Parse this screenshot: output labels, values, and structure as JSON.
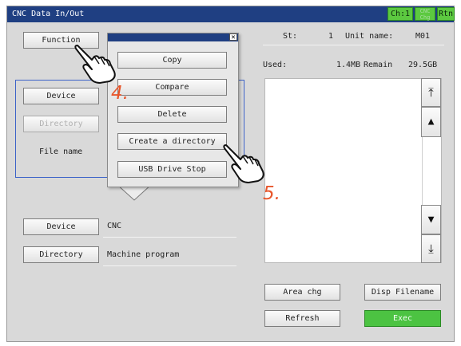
{
  "window": {
    "title": "CNC Data In/Out",
    "ch_label": "Ch:1",
    "cnc_chg_line1": "CNC",
    "cnc_chg_line2": "Chg",
    "rtn_label": "Rtn"
  },
  "status": {
    "st_label": "St:",
    "st_value": "1",
    "unit_label": "Unit name:",
    "unit_value": "M01",
    "used_label": "Used:",
    "used_value": "1.4MB",
    "remain_label": "Remain",
    "remain_value": "29.5GB"
  },
  "source": {
    "function_label": "Function",
    "device_label": "Device",
    "directory_label": "Directory",
    "filename_label": "File name"
  },
  "popup": {
    "close_glyph": "✕",
    "items": [
      "Copy",
      "Compare",
      "Delete",
      "Create a directory",
      "USB Drive Stop"
    ]
  },
  "dest": {
    "device_label": "Device",
    "device_value": "CNC",
    "directory_label": "Directory",
    "directory_value": "Machine program"
  },
  "scroll": {
    "top_glyph": "⤒",
    "up_glyph": "▲",
    "down_glyph": "▼",
    "bottom_glyph": "⤓"
  },
  "actions": {
    "area_chg": "Area chg",
    "disp_filename": "Disp Filename",
    "refresh": "Refresh",
    "exec": "Exec"
  },
  "annotations": {
    "step4": "4.",
    "step5": "5."
  },
  "colors": {
    "title_bar": "#1f3f82",
    "accent_green": "#4cc342",
    "step_orange": "#e8562b",
    "box_blue": "#3c62c8"
  }
}
